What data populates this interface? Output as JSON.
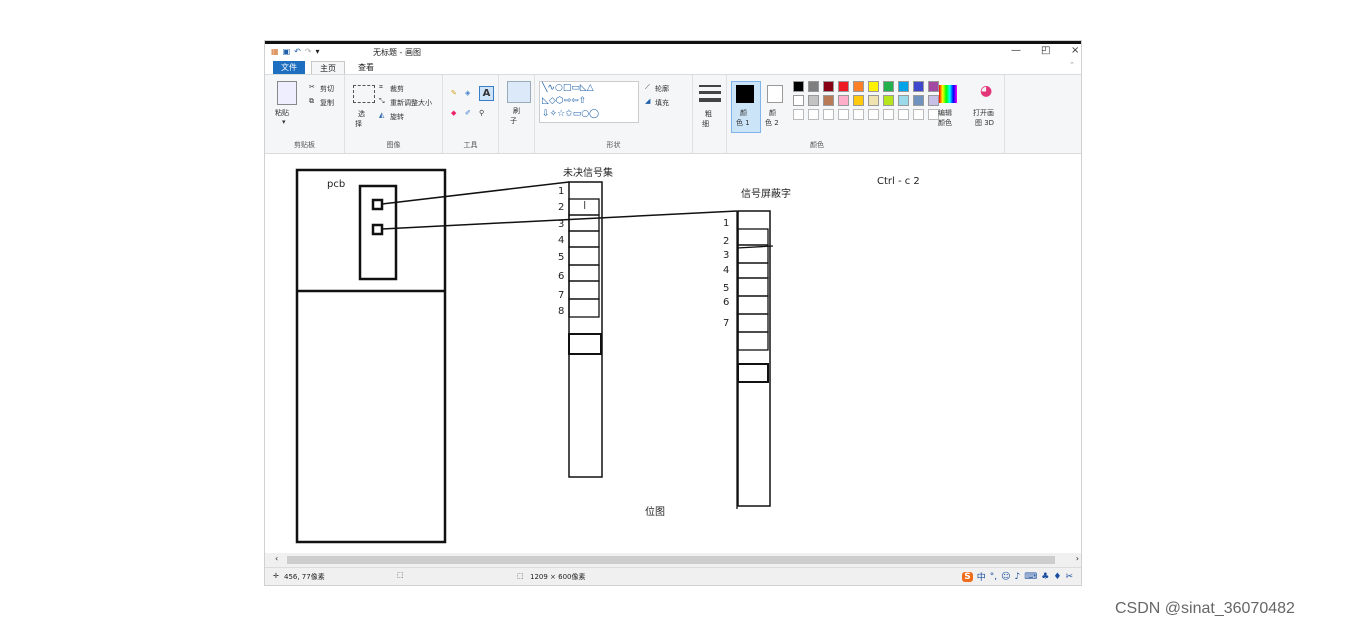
{
  "titlebar": {
    "title": "无标题 - 画图",
    "minimize": "—",
    "restore": "◰",
    "close": "×"
  },
  "tabs": {
    "file": "文件",
    "home": "主页",
    "view": "查看"
  },
  "clipboard": {
    "paste": "粘贴",
    "cut": "剪切",
    "copy": "复制",
    "label": "剪贴板"
  },
  "image": {
    "select_line1": "选",
    "select_line2": "择",
    "crop": "裁剪",
    "resize": "重新调整大小",
    "rotate": "旋转",
    "label": "图像"
  },
  "tools": {
    "label": "工具",
    "brush_line1": "刷",
    "brush_line2": "子"
  },
  "shapes": {
    "outline": "轮廓",
    "fill": "填充",
    "label": "形状"
  },
  "size": {
    "line1": "粗",
    "line2": "细"
  },
  "colors": {
    "color1_line1": "颜",
    "color1_line2": "色 1",
    "color2_line1": "颜",
    "color2_line2": "色 2",
    "edit_line1": "编辑",
    "edit_line2": "颜色",
    "paint3d_line1": "打开画",
    "paint3d_line2": "图 3D",
    "label": "颜色",
    "palette_row1": [
      "#000000",
      "#7f7f7f",
      "#880015",
      "#ed1c24",
      "#ff7f27",
      "#fff200",
      "#22b14c",
      "#00a2e8",
      "#3f48cc",
      "#a349a4"
    ],
    "palette_row2": [
      "#ffffff",
      "#c3c3c3",
      "#b97a57",
      "#ffaec9",
      "#ffc90e",
      "#efe4b0",
      "#b5e61d",
      "#99d9ea",
      "#7092be",
      "#c8bfe7"
    ]
  },
  "canvas": {
    "pcb": "pcb",
    "pending_title": "未决信号集",
    "pending_numbers": [
      "1",
      "2",
      "3",
      "4",
      "5",
      "6",
      "7",
      "8"
    ],
    "mask_title": "信号屏蔽字",
    "mask_numbers": [
      "1",
      "2",
      "3",
      "4",
      "5",
      "6",
      "7"
    ],
    "ctrl": "Ctrl - c  2",
    "bitmap": "位图"
  },
  "status": {
    "cursor": "456, 77像素",
    "selection_icon": "⬚",
    "size": "1209 × 600像素"
  },
  "ime": {
    "mode": "中"
  },
  "watermark": "CSDN @sinat_36070482"
}
